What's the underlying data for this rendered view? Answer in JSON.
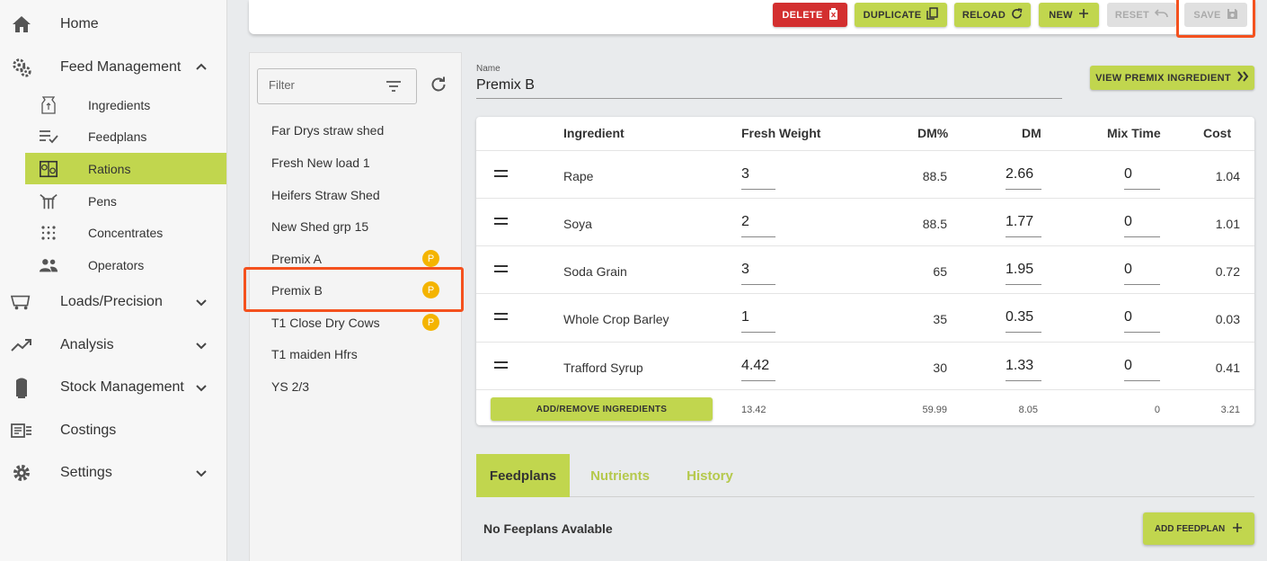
{
  "sidebar": {
    "home": "Home",
    "feed_management": "Feed Management",
    "sub_items": {
      "ingredients": "Ingredients",
      "feedplans": "Feedplans",
      "rations": "Rations",
      "pens": "Pens",
      "concentrates": "Concentrates",
      "operators": "Operators"
    },
    "loads_precision": "Loads/Precision",
    "analysis": "Analysis",
    "stock_management": "Stock Management",
    "costings": "Costings",
    "settings": "Settings"
  },
  "toolbar": {
    "delete": "DELETE",
    "duplicate": "DUPLICATE",
    "reload": "RELOAD",
    "new": "NEW",
    "reset": "RESET",
    "save": "SAVE"
  },
  "list": {
    "filter_placeholder": "Filter",
    "items": [
      {
        "label": "Far Drys straw shed",
        "badge": ""
      },
      {
        "label": "Fresh New load 1",
        "badge": ""
      },
      {
        "label": "Heifers Straw Shed",
        "badge": ""
      },
      {
        "label": "New Shed grp 15",
        "badge": ""
      },
      {
        "label": "Premix A",
        "badge": "P"
      },
      {
        "label": "Premix B",
        "badge": "P"
      },
      {
        "label": "T1 Close Dry Cows",
        "badge": "P"
      },
      {
        "label": "T1 maiden Hfrs",
        "badge": ""
      },
      {
        "label": "YS 2/3",
        "badge": ""
      }
    ]
  },
  "detail": {
    "name_label": "Name",
    "name_value": "Premix B",
    "view_premix_button": "VIEW PREMIX INGREDIENT"
  },
  "table": {
    "headers": {
      "ingredient": "Ingredient",
      "fresh_weight": "Fresh Weight",
      "dm_pct": "DM%",
      "dm": "DM",
      "mix_time": "Mix Time",
      "cost": "Cost"
    },
    "rows": [
      {
        "ingredient": "Rape",
        "fresh_weight": "3",
        "dm_pct": "88.5",
        "dm": "2.66",
        "mix_time": "0",
        "cost": "1.04"
      },
      {
        "ingredient": "Soya",
        "fresh_weight": "2",
        "dm_pct": "88.5",
        "dm": "1.77",
        "mix_time": "0",
        "cost": "1.01"
      },
      {
        "ingredient": "Soda Grain",
        "fresh_weight": "3",
        "dm_pct": "65",
        "dm": "1.95",
        "mix_time": "0",
        "cost": "0.72"
      },
      {
        "ingredient": "Whole Crop Barley",
        "fresh_weight": "1",
        "dm_pct": "35",
        "dm": "0.35",
        "mix_time": "0",
        "cost": "0.03"
      },
      {
        "ingredient": "Trafford Syrup",
        "fresh_weight": "4.42",
        "dm_pct": "30",
        "dm": "1.33",
        "mix_time": "0",
        "cost": "0.41"
      }
    ],
    "add_remove_button": "ADD/REMOVE INGREDIENTS",
    "totals": {
      "fresh_weight": "13.42",
      "dm_pct": "59.99",
      "dm": "8.05",
      "mix_time": "0",
      "cost": "3.21"
    }
  },
  "tabs": {
    "feedplans": "Feedplans",
    "nutrients": "Nutrients",
    "history": "History"
  },
  "feedplans_panel": {
    "empty_message": "No Feeplans Avalable",
    "add_button": "ADD FEEDPLAN"
  },
  "colors": {
    "accent": "#c1d64e",
    "danger": "#d32f2f",
    "highlight": "#f4511e",
    "badge": "#f4b400"
  }
}
